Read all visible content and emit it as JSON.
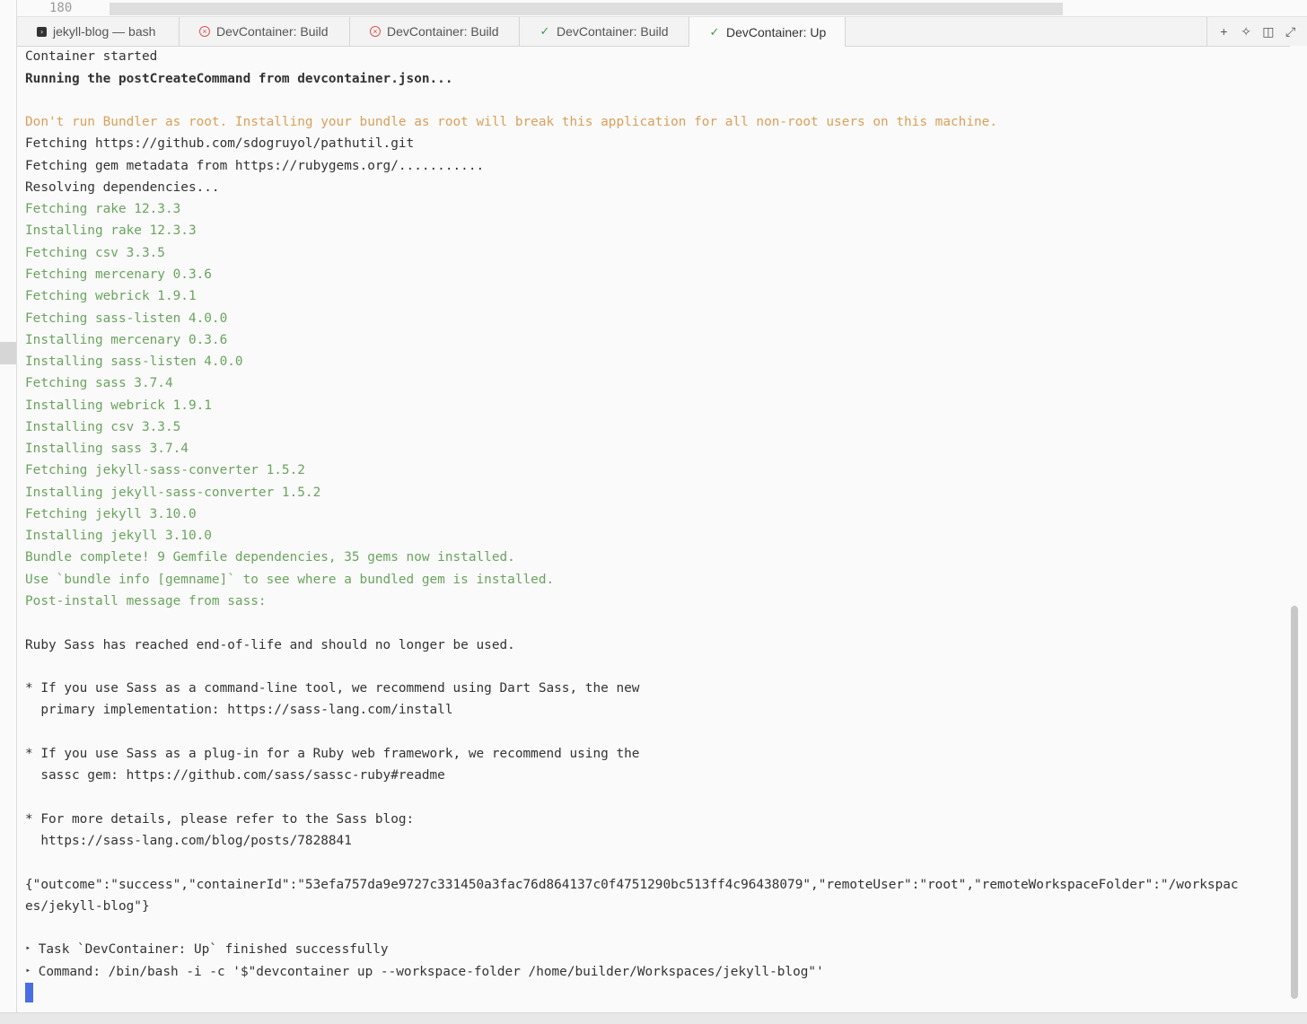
{
  "editor": {
    "line_number": "180"
  },
  "tabs": [
    {
      "label": "jekyll-blog — bash",
      "status": "terminal"
    },
    {
      "label": "DevContainer: Build",
      "status": "error"
    },
    {
      "label": "DevContainer: Build",
      "status": "error"
    },
    {
      "label": "DevContainer: Build",
      "status": "success"
    },
    {
      "label": "DevContainer: Up",
      "status": "success",
      "active": true
    }
  ],
  "tab_tools": [
    {
      "icon": "plus-icon"
    },
    {
      "icon": "sparkle-icon"
    },
    {
      "icon": "split-pane-icon"
    },
    {
      "icon": "maximize-icon"
    }
  ],
  "colors": {
    "warning": "#d9a05b",
    "success": "#6aa35e",
    "error": "#d9534f",
    "cursor": "#4a6fe3"
  },
  "terminal": {
    "lines": [
      "Container started",
      "Running the postCreateCommand from devcontainer.json...",
      "Don't run Bundler as root. Installing your bundle as root will break this application for all non-root users on this machine.",
      "Fetching https://github.com/sdogruyol/pathutil.git",
      "Fetching gem metadata from https://rubygems.org/...........",
      "Resolving dependencies...",
      "Fetching rake 12.3.3",
      "Installing rake 12.3.3",
      "Fetching csv 3.3.5",
      "Fetching mercenary 0.3.6",
      "Fetching webrick 1.9.1",
      "Fetching sass-listen 4.0.0",
      "Installing mercenary 0.3.6",
      "Installing sass-listen 4.0.0",
      "Fetching sass 3.7.4",
      "Installing webrick 1.9.1",
      "Installing csv 3.3.5",
      "Installing sass 3.7.4",
      "Fetching jekyll-sass-converter 1.5.2",
      "Installing jekyll-sass-converter 1.5.2",
      "Fetching jekyll 3.10.0",
      "Installing jekyll 3.10.0",
      "Bundle complete! 9 Gemfile dependencies, 35 gems now installed.",
      "Use `bundle info [gemname]` to see where a bundled gem is installed.",
      "Post-install message from sass:",
      "Ruby Sass has reached end-of-life and should no longer be used.",
      "* If you use Sass as a command-line tool, we recommend using Dart Sass, the new",
      "  primary implementation: https://sass-lang.com/install",
      "* If you use Sass as a plug-in for a Ruby web framework, we recommend using the",
      "  sassc gem: https://github.com/sass/sassc-ruby#readme",
      "* For more details, please refer to the Sass blog:",
      "  https://sass-lang.com/blog/posts/7828841",
      "{\"outcome\":\"success\",\"containerId\":\"53efa757da9e9727c331450a3fac76d864137c0f4751290bc513ff4c96438079\",\"remoteUser\":\"root\",\"remoteWorkspaceFolder\":\"/workspac",
      "es/jekyll-blog\"}",
      "Task `DevContainer: Up` finished successfully",
      "Command: /bin/bash -i -c '$\"devcontainer up --workspace-folder /home/builder/Workspaces/jekyll-blog\"'"
    ],
    "bullet_glyph": "‣"
  }
}
